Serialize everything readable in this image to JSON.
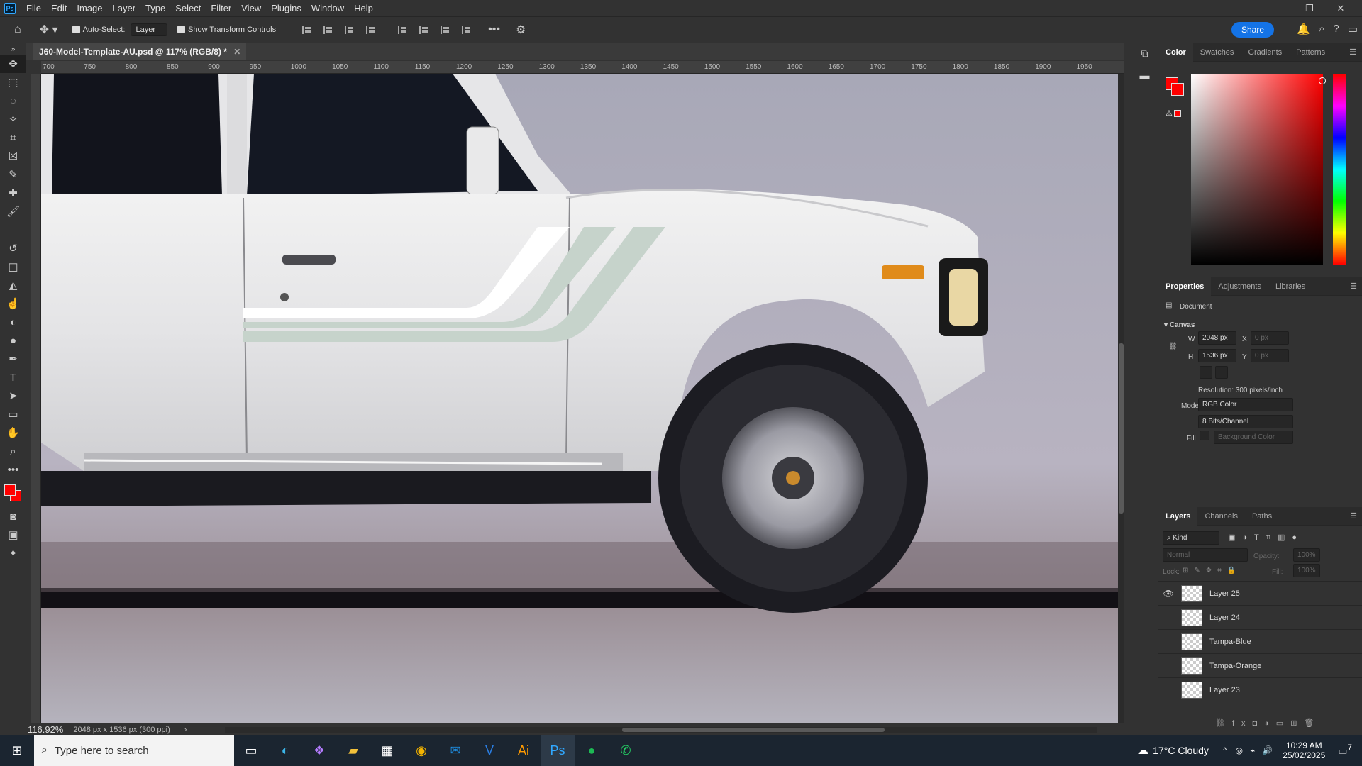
{
  "app": {
    "logo": "Ps"
  },
  "menu": [
    "File",
    "Edit",
    "Image",
    "Layer",
    "Type",
    "Select",
    "Filter",
    "View",
    "Plugins",
    "Window",
    "Help"
  ],
  "options": {
    "auto_select_label": "Auto-Select:",
    "auto_select_value": "Layer",
    "transform_label": "Show Transform Controls",
    "share_label": "Share"
  },
  "document": {
    "tab_title": "J60-Model-Template-AU.psd @ 117% (RGB/8) *",
    "zoom": "116.92%",
    "info": "2048 px x 1536 px (300 ppi)"
  },
  "ruler": {
    "top_labels": [
      "700",
      "750",
      "800",
      "850",
      "900",
      "950",
      "1000",
      "1050",
      "1100",
      "1150",
      "1200",
      "1250",
      "1300",
      "1350",
      "1400",
      "1450",
      "1500",
      "1550",
      "1600",
      "1650",
      "1700",
      "1750",
      "1800",
      "1850",
      "1900",
      "1950"
    ]
  },
  "color_panel": {
    "tabs": [
      "Color",
      "Swatches",
      "Gradients",
      "Patterns"
    ],
    "foreground": "#ff0000",
    "background": "#ff0000"
  },
  "properties": {
    "tabs": [
      "Properties",
      "Adjustments",
      "Libraries"
    ],
    "document_label": "Document",
    "canvas_label": "Canvas",
    "w_label": "W",
    "w_value": "2048 px",
    "h_label": "H",
    "h_value": "1536 px",
    "x_label": "X",
    "x_value": "0 px",
    "y_label": "Y",
    "y_value": "0 px",
    "resolution": "Resolution: 300 pixels/inch",
    "mode_label": "Mode",
    "mode_value": "RGB Color",
    "bits_value": "8 Bits/Channel",
    "fill_label": "Fill",
    "fill_value": "Background Color"
  },
  "layers_panel": {
    "tabs": [
      "Layers",
      "Channels",
      "Paths"
    ],
    "kind_label": "Kind",
    "blend_mode": "Normal",
    "opacity_label": "Opacity:",
    "opacity_value": "100%",
    "lock_label": "Lock:",
    "fill_label": "Fill:",
    "fill_value": "100%",
    "layers": [
      {
        "name": "Layer 25",
        "visible": true
      },
      {
        "name": "Layer 24",
        "visible": false
      },
      {
        "name": "Tampa-Blue",
        "visible": false
      },
      {
        "name": "Tampa-Orange",
        "visible": false
      },
      {
        "name": "Layer 23",
        "visible": false
      }
    ]
  },
  "taskbar": {
    "search_placeholder": "Type here to search",
    "weather": "17°C  Cloudy",
    "time": "10:29 AM",
    "date": "25/02/2025",
    "notifications": "7"
  }
}
